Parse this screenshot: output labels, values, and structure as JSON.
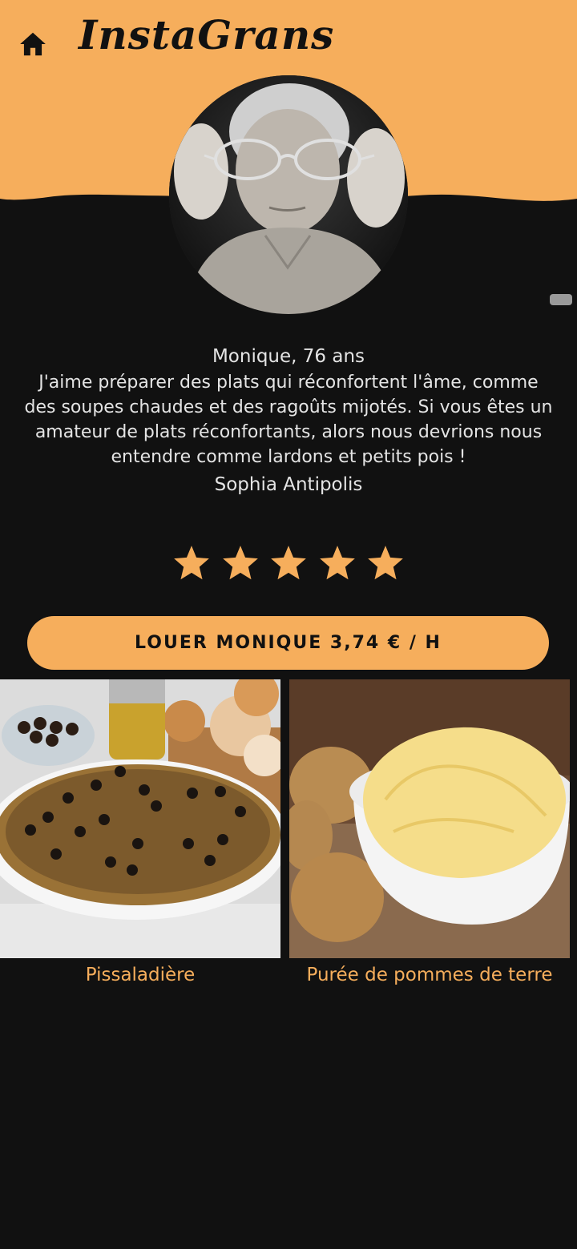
{
  "header": {
    "title": "InstaGrans",
    "background_color": "#F6AE5C",
    "home_icon": "home-icon"
  },
  "profile": {
    "name_age": "Monique, 76 ans",
    "bio": "J'aime préparer des plats qui réconfortent l'âme, comme des soupes chaudes et des ragoûts mijotés. Si vous êtes un amateur de plats réconfortants, alors nous devrions nous entendre comme lardons et petits pois !",
    "location": "Sophia Antipolis",
    "rating": 5,
    "rating_max": 5,
    "avatar_description_icon": "avatar-photo"
  },
  "rent_button": {
    "label": "LOUER MONIQUE 3,74 € / H"
  },
  "dishes": [
    {
      "label": "Pissaladière"
    },
    {
      "label": "Purée de pommes de terre"
    }
  ],
  "colors": {
    "accent": "#F6AE5C",
    "background": "#111111",
    "text": "#e4e4e4"
  }
}
